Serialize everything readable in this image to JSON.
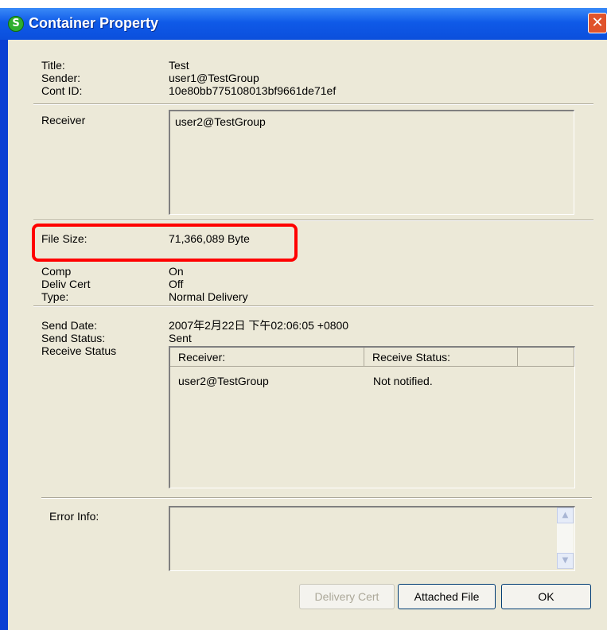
{
  "window": {
    "title": "Container Property",
    "close_glyph": "✕"
  },
  "info": {
    "title_label": "Title:",
    "title_value": "Test",
    "sender_label": "Sender:",
    "sender_value": "user1@TestGroup",
    "contid_label": "Cont ID:",
    "contid_value": "10e80bb775108013bf9661de71ef"
  },
  "receiver": {
    "label": "Receiver",
    "list": [
      "user2@TestGroup"
    ]
  },
  "file": {
    "size_label": "File Size:",
    "size_value": "71,366,089 Byte"
  },
  "options": {
    "comp_label": "Comp",
    "comp_value": "On",
    "deliv_label": "Deliv Cert",
    "deliv_value": "Off",
    "type_label": "Type:",
    "type_value": "Normal Delivery"
  },
  "send": {
    "date_label": "Send Date:",
    "date_value": "2007年2月22日 下午02:06:05 +0800",
    "status_label": "Send Status:",
    "status_value": "Sent",
    "receive_status_label": "Receive Status"
  },
  "status_table": {
    "columns": [
      "Receiver:",
      "Receive Status:"
    ],
    "rows": [
      {
        "receiver": "user2@TestGroup",
        "status": "Not notified."
      }
    ]
  },
  "error": {
    "label": "Error Info:",
    "value": ""
  },
  "buttons": {
    "delivery_cert": "Delivery Cert",
    "attached_file": "Attached File",
    "ok": "OK"
  },
  "icons": {
    "app": "app-logo-icon",
    "scroll_up": "scroll-up-icon",
    "scroll_down": "scroll-down-icon"
  },
  "colors": {
    "titlebar": "#0b4fdc",
    "highlight": "#ff0000",
    "dialog_bg": "#ece9d8"
  }
}
